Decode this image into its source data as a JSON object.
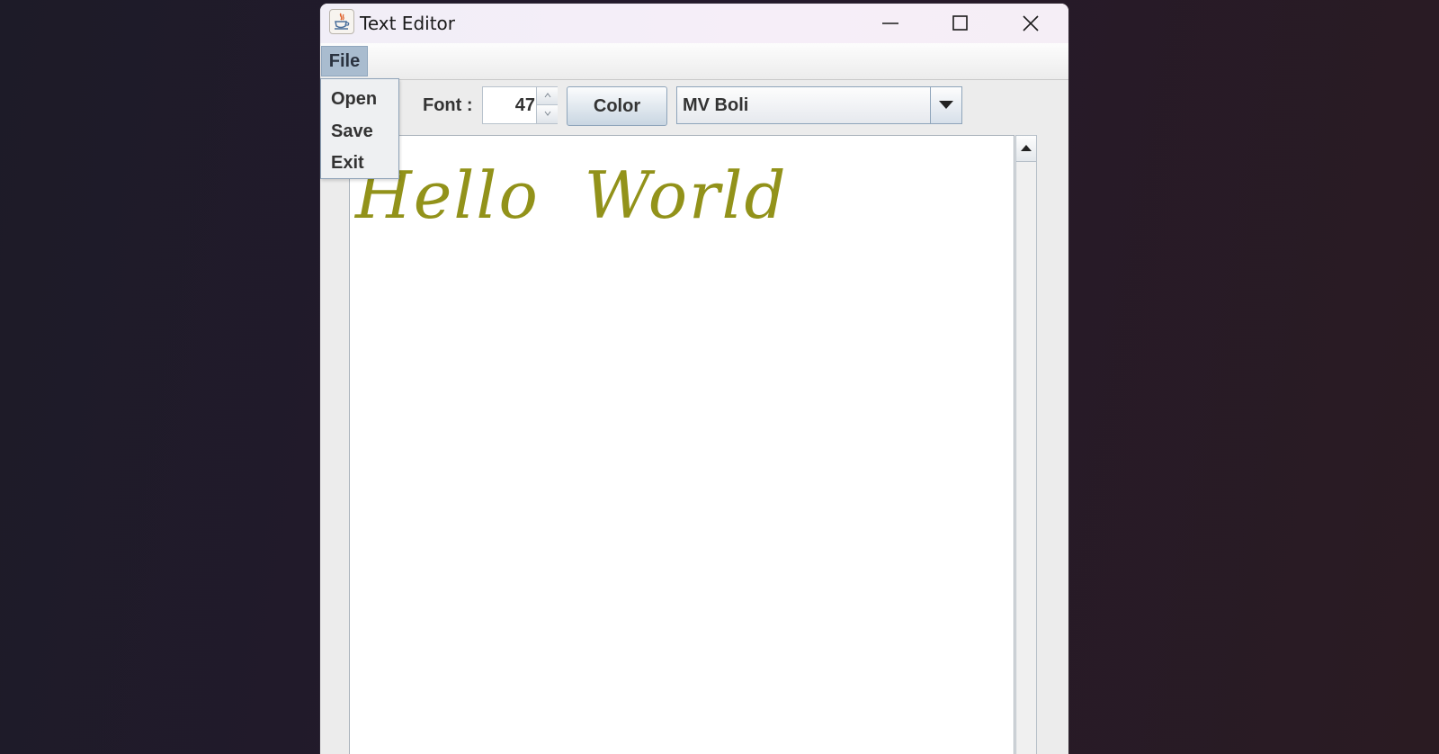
{
  "window": {
    "title": "Text Editor",
    "controls": [
      "minimize",
      "maximize",
      "close"
    ]
  },
  "menubar": {
    "items": [
      {
        "label": "File",
        "open": true
      }
    ]
  },
  "file_menu": {
    "items": [
      {
        "label": "Open"
      },
      {
        "label": "Save"
      },
      {
        "label": "Exit"
      }
    ]
  },
  "toolbar": {
    "font_label": "Font :",
    "font_size": "47",
    "color_button": "Color",
    "font_family_selected": "MV Boli"
  },
  "editor": {
    "text": "Hello  World",
    "text_color": "#92921a"
  },
  "icons": {
    "app": "java-cup-icon",
    "minimize": "minimize-icon",
    "maximize": "maximize-icon",
    "close": "close-icon",
    "spinner_up": "chevron-up-icon",
    "spinner_down": "chevron-down-icon",
    "combo_arrow": "dropdown-arrow-icon",
    "scroll_up": "scroll-up-arrow-icon"
  }
}
